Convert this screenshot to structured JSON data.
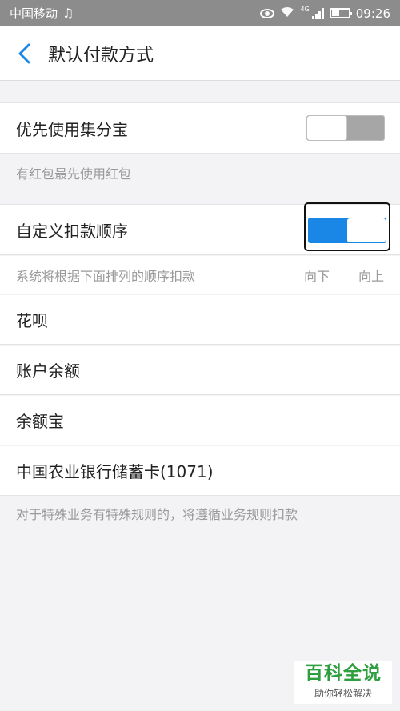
{
  "status_bar": {
    "carrier": "中国移动",
    "network_badge": "4G",
    "time": "09:26"
  },
  "header": {
    "title": "默认付款方式"
  },
  "section_points": {
    "label": "优先使用集分宝",
    "toggle_on": false,
    "hint": "有红包最先使用红包"
  },
  "section_order": {
    "label": "自定义扣款顺序",
    "toggle_on": true,
    "hint": "系统将根据下面排列的顺序扣款",
    "move_down": "向下",
    "move_up": "向上"
  },
  "payment_methods": [
    {
      "label": "花呗"
    },
    {
      "label": "账户余额"
    },
    {
      "label": "余额宝"
    },
    {
      "label": "中国农业银行储蓄卡(1071)"
    }
  ],
  "footer_note": "对于特殊业务有特殊规则的，将遵循业务规则扣款",
  "watermark": {
    "main": "百科全说",
    "sub": "助你轻松解决"
  },
  "colors": {
    "accent": "#1a87e6",
    "toggle_off": "#a6a6a6",
    "watermark_green": "#2e9f3e"
  }
}
